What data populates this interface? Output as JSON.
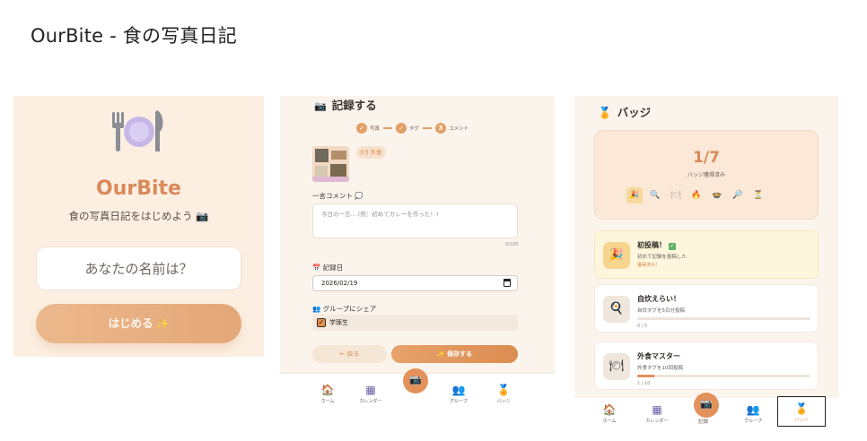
{
  "page_title": "OurBite - 食の写真日記",
  "screen1": {
    "app_name": "OurBite",
    "tagline": "食の写真日記をはじめよう 📷",
    "name_placeholder": "あなたの名前は？",
    "start_label": "はじめる",
    "start_icon": "✨"
  },
  "screen2": {
    "header_icon": "📷",
    "header": "記録する",
    "steps": [
      {
        "num": "✓",
        "label": "写真"
      },
      {
        "num": "✓",
        "label": "タグ"
      },
      {
        "num": "3",
        "label": "コメント"
      }
    ],
    "tag_chip": "🍽 外食",
    "comment_label": "一言コメント 💭",
    "comment_placeholder": "今日の一言... (例：初めてカレーを作った！)",
    "counter": "0/100",
    "date_label": "📅 記録日",
    "date_value": "2026/02/19",
    "share_label": "👥 グループにシェア",
    "share_group": "学琢生",
    "back_label": "← 戻る",
    "save_label": "✨ 保存する"
  },
  "nav": {
    "home": "ホーム",
    "calendar": "カレンダー",
    "record": "記録",
    "group": "グループ",
    "badge": "バッジ"
  },
  "screen3": {
    "header_icon": "🏅",
    "header": "バッジ",
    "count": "1/7",
    "count_label": "バッジ獲得済み",
    "badges": [
      "🎉",
      "🔍",
      "🍽",
      "🔥",
      "🍲",
      "🔎",
      "⏳"
    ],
    "cards": [
      {
        "title": "初投稿！",
        "desc": "初めて記録を投稿した",
        "status": "獲得済み！",
        "icon": "🎉",
        "earned": true
      },
      {
        "title": "自炊えらい！",
        "desc": "自炊タグを5日分投稿",
        "progress": "0 / 5",
        "fraction": 0,
        "icon": "🍳",
        "earned": false
      },
      {
        "title": "外食マスター",
        "desc": "外食タグを10回投稿",
        "progress": "1 / 10",
        "fraction": 0.1,
        "icon": "🍽",
        "earned": false
      }
    ]
  },
  "colors": {
    "accent": "#e3905a",
    "background": "#fbf4ec"
  }
}
